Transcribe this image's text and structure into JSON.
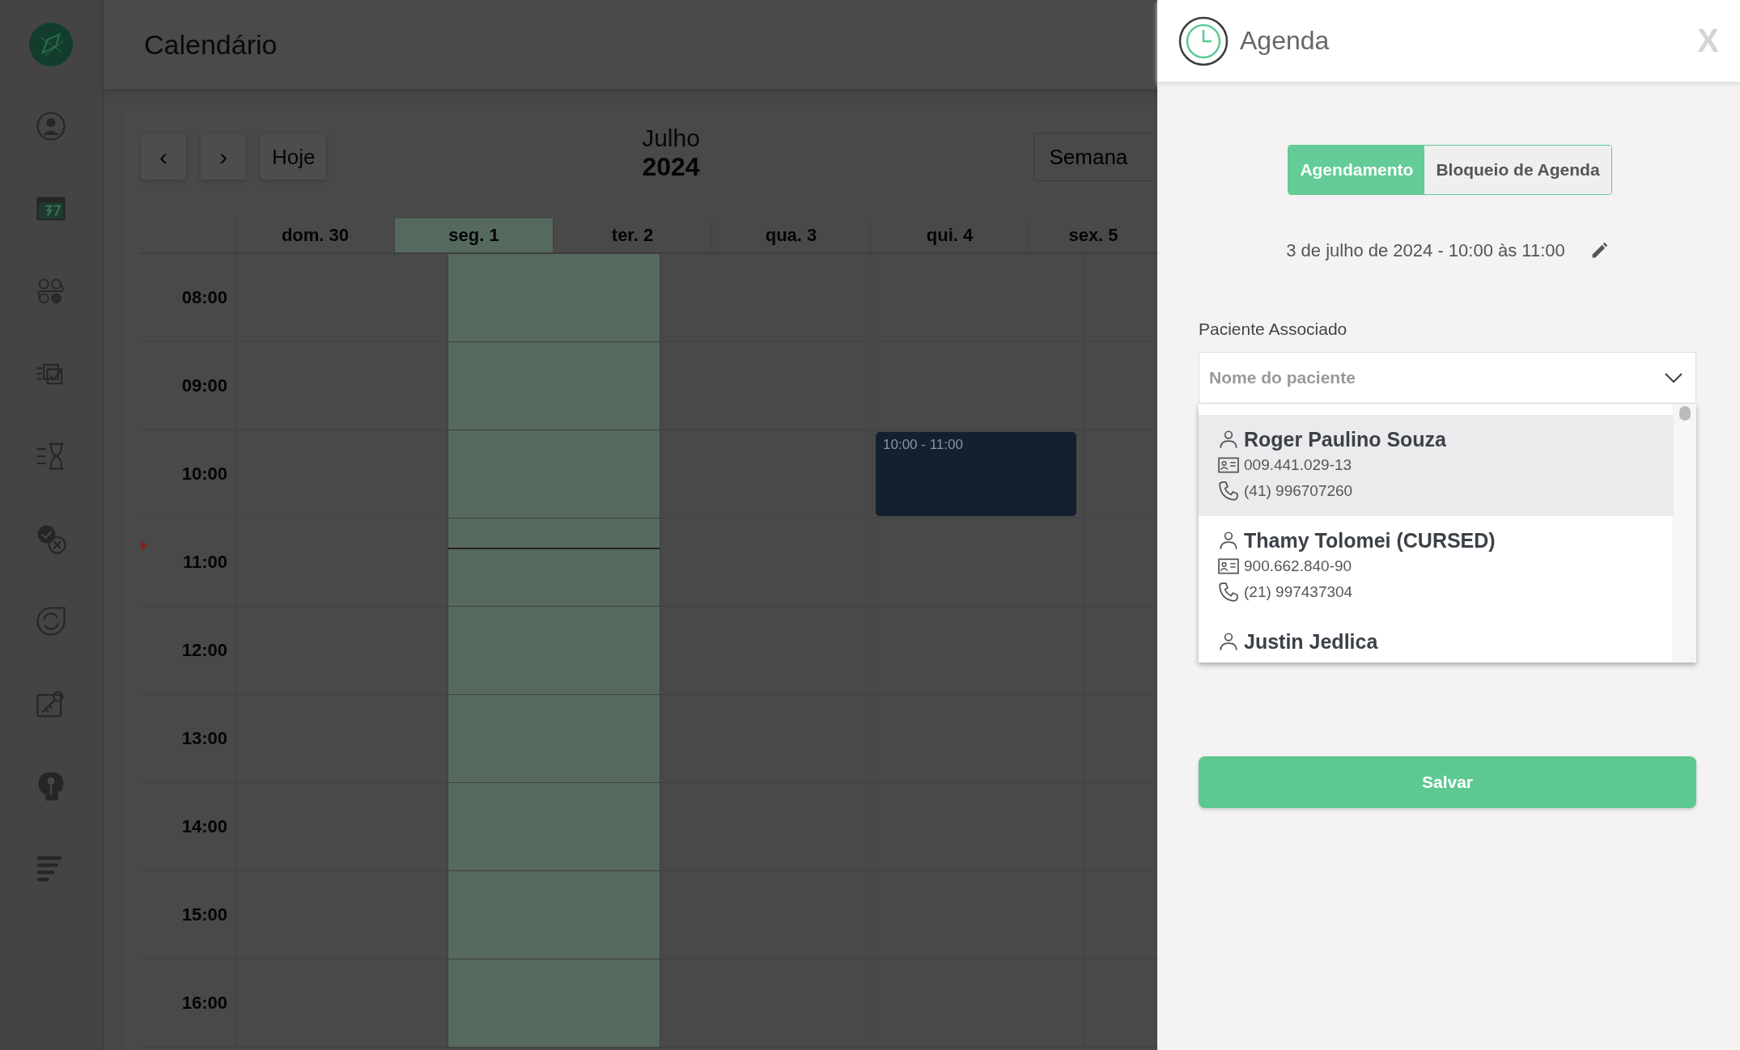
{
  "page": {
    "title": "Calendário"
  },
  "calendar": {
    "nav": {
      "prev": "‹",
      "next": "›",
      "today": "Hoje"
    },
    "month": "Julho",
    "year": "2024",
    "view": "Semana",
    "days": [
      {
        "label": "dom. 30",
        "selected": false
      },
      {
        "label": "seg. 1",
        "selected": true
      },
      {
        "label": "ter. 2",
        "selected": false
      },
      {
        "label": "qua. 3",
        "selected": false
      },
      {
        "label": "qui. 4",
        "selected": false
      },
      {
        "label": "sex. 5",
        "selected": false
      }
    ],
    "rows": [
      {
        "time": "08:00",
        "now": false,
        "cells": [
          {
            "today": false
          },
          {
            "today": true
          },
          {
            "today": false
          },
          {
            "today": false
          },
          {
            "today": false
          }
        ]
      },
      {
        "time": "09:00",
        "now": false,
        "cells": [
          {
            "today": false
          },
          {
            "today": true
          },
          {
            "today": false
          },
          {
            "today": false
          },
          {
            "today": false
          }
        ]
      },
      {
        "time": "10:00",
        "now": false,
        "cells": [
          {
            "today": false
          },
          {
            "today": true
          },
          {
            "today": false
          },
          {
            "today": false,
            "event": "10:00 - 11:00"
          },
          {
            "today": false
          }
        ]
      },
      {
        "time": "11:00",
        "now": true,
        "cells": [
          {
            "today": false
          },
          {
            "today": true
          },
          {
            "today": false
          },
          {
            "today": false
          },
          {
            "today": false
          }
        ]
      },
      {
        "time": "12:00",
        "now": false,
        "cells": [
          {
            "today": false
          },
          {
            "today": true
          },
          {
            "today": false
          },
          {
            "today": false
          },
          {
            "today": false
          }
        ]
      },
      {
        "time": "13:00",
        "now": false,
        "cells": [
          {
            "today": false
          },
          {
            "today": true
          },
          {
            "today": false
          },
          {
            "today": false
          },
          {
            "today": false
          }
        ]
      },
      {
        "time": "14:00",
        "now": false,
        "cells": [
          {
            "today": false
          },
          {
            "today": true
          },
          {
            "today": false
          },
          {
            "today": false
          },
          {
            "today": false
          }
        ]
      },
      {
        "time": "15:00",
        "now": false,
        "cells": [
          {
            "today": false
          },
          {
            "today": true
          },
          {
            "today": false
          },
          {
            "today": false
          },
          {
            "today": false
          }
        ]
      },
      {
        "time": "16:00",
        "now": false,
        "cells": [
          {
            "today": false
          },
          {
            "today": true
          },
          {
            "today": false
          },
          {
            "today": false
          },
          {
            "today": false
          }
        ]
      }
    ]
  },
  "panel": {
    "title": "Agenda",
    "close": "X",
    "tabs": [
      {
        "label": "Agendamento",
        "selected": true
      },
      {
        "label": "Bloqueio de Agenda",
        "selected": false
      }
    ],
    "date": "3 de julho de 2024 - 10:00 às 11:00",
    "patient_field": {
      "label": "Paciente Associado",
      "placeholder": "Nome do paciente",
      "expanded": true
    },
    "patients": [
      {
        "name": "Roger Paulino Souza",
        "document": "009.441.029-13",
        "phone": "(41) 996707260",
        "selected": true
      },
      {
        "name": "Thamy Tolomei (CURSED)",
        "document": "900.662.840-90",
        "phone": "(21) 997437304",
        "selected": false
      },
      {
        "name": "Justin Jedlica",
        "selected": false
      }
    ],
    "save": "Salvar"
  }
}
